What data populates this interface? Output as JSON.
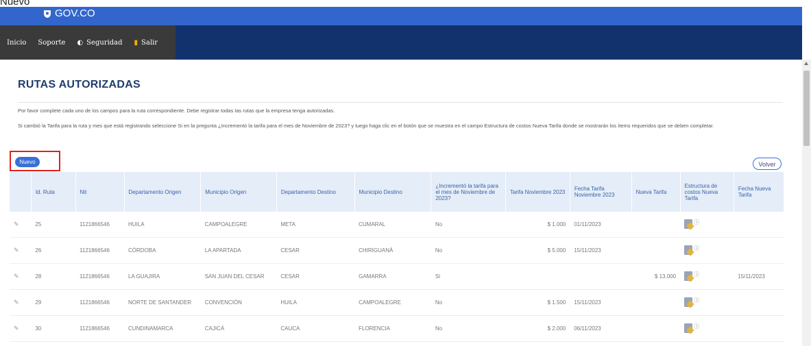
{
  "page": {
    "caption": "Nuevo"
  },
  "header": {
    "brand": "GOV.CO"
  },
  "nav": [
    {
      "label": "Inicio",
      "icon": ""
    },
    {
      "label": "Soporte",
      "icon": ""
    },
    {
      "label": "Seguridad",
      "icon": "shield-icon"
    },
    {
      "label": "Salir",
      "icon": "lock-icon"
    }
  ],
  "main": {
    "title": "RUTAS AUTORIZADAS",
    "intro1": "Por favor complete cada uno de los campos para la ruta correspondiente. Debe registrar todas las rutas que la empresa tenga autorizadas.",
    "intro2": "Si cambió la Tarifa para la ruta y mes que está registrando seleccione Si en la pregunta ¿Incrementó la tarifa para el mes de Noviembre de 2023? y luego haga clic en el botón que se muestra en el campo Estructura de costos Nueva Tarifa donde se mostrarán los ítems requeridos que se deben completar.",
    "new_button": "Nuevo",
    "back_button": "Volver"
  },
  "table": {
    "headers": [
      "",
      "Id. Ruta",
      "Nit",
      "Departamento Origen",
      "Municipio Origen",
      "Departamento Destino",
      "Municipio Destino",
      "¿Incrementó la tarifa para el mes de Noviembre de 2023?",
      "Tarifa Noviembre 2023",
      "Fecha Tarifa Noviembre 2023",
      "Nueva Tarifa",
      "Estructura de costos Nueva Tarifa",
      "Fecha Nueva Tarifa"
    ],
    "rows": [
      {
        "id": "25",
        "nit": "1121866546",
        "dep_origen": "HUILA",
        "mun_origen": "CAMPOALEGRE",
        "dep_destino": "META",
        "mun_destino": "CUMARAL",
        "incremento": "No",
        "tarifa": "$ 1.000",
        "fecha_tarifa": "01/11/2023",
        "nueva_tarifa": "",
        "fecha_nueva": ""
      },
      {
        "id": "26",
        "nit": "1121866546",
        "dep_origen": "CÓRDOBA",
        "mun_origen": "LA APARTADA",
        "dep_destino": "CESAR",
        "mun_destino": "CHIRIGUANÁ",
        "incremento": "No",
        "tarifa": "$ 5.000",
        "fecha_tarifa": "15/11/2023",
        "nueva_tarifa": "",
        "fecha_nueva": ""
      },
      {
        "id": "28",
        "nit": "1121866546",
        "dep_origen": "LA GUAJIRA",
        "mun_origen": "SAN JUAN DEL CESAR",
        "dep_destino": "CESAR",
        "mun_destino": "GAMARRA",
        "incremento": "Si",
        "tarifa": "",
        "fecha_tarifa": "",
        "nueva_tarifa": "$ 13.000",
        "fecha_nueva": "15/11/2023"
      },
      {
        "id": "29",
        "nit": "1121866546",
        "dep_origen": "NORTE DE SANTANDER",
        "mun_origen": "CONVENCIÓN",
        "dep_destino": "HUILA",
        "mun_destino": "CAMPOALEGRE",
        "incremento": "No",
        "tarifa": "$ 1.500",
        "fecha_tarifa": "15/11/2023",
        "nueva_tarifa": "",
        "fecha_nueva": ""
      },
      {
        "id": "30",
        "nit": "1121866546",
        "dep_origen": "CUNDINAMARCA",
        "mun_origen": "CAJICÁ",
        "dep_destino": "CAUCA",
        "mun_destino": "FLORENCIA",
        "incremento": "No",
        "tarifa": "$ 2.000",
        "fecha_tarifa": "06/11/2023",
        "nueva_tarifa": "",
        "fecha_nueva": ""
      }
    ]
  },
  "colors": {
    "topbar": "#3366cc",
    "navband": "#12326d",
    "menu": "#3a3a3a",
    "accent": "#3a6fd6",
    "header_bg": "#e4edf8",
    "highlight": "#e02020"
  }
}
